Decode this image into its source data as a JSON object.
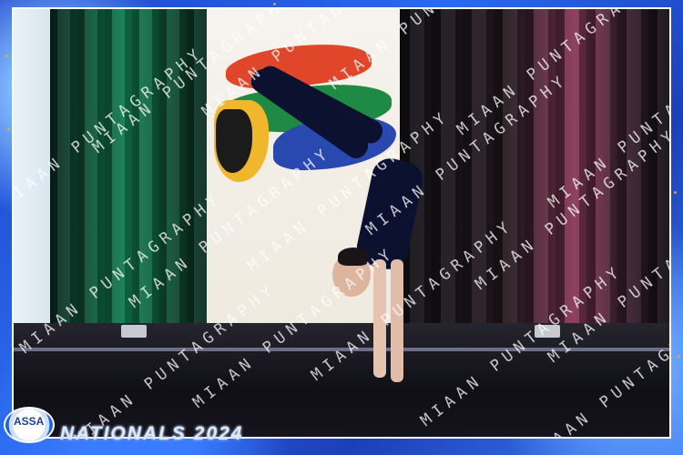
{
  "photo": {
    "description_colors": {
      "frame_blue": "#1f50d8",
      "stage_dark": "#0f0f15",
      "banner_white": "#f6f3ee"
    }
  },
  "branding": {
    "logo_text": "ASSA",
    "event_title": "NATIONALS 2024"
  },
  "watermark": {
    "text": "MIAAN PUNTAGRAPHY"
  }
}
